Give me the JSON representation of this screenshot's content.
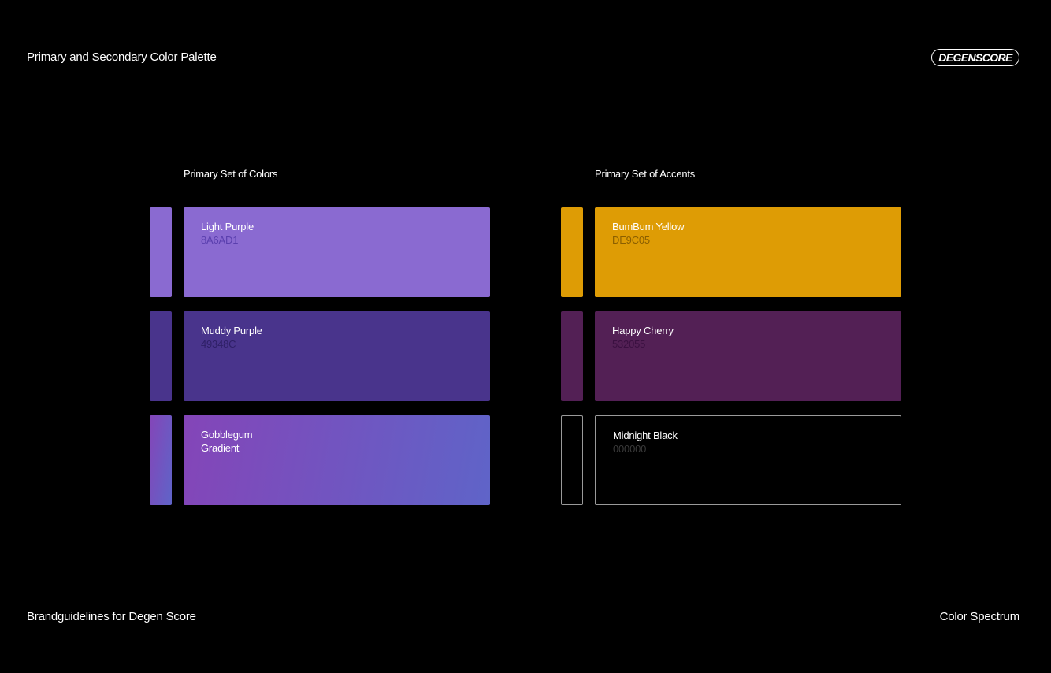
{
  "header": {
    "title": "Primary and Secondary Color Palette",
    "logo_text": "DEGENSCORE"
  },
  "footer": {
    "left": "Brandguidelines for Degen Score",
    "right": "Color Spectrum"
  },
  "primary": {
    "heading": "Primary Set of Colors",
    "swatches": [
      {
        "name": "Light Purple",
        "hex": "8A6AD1",
        "color": "#8A6AD1",
        "hex_text_color": "#5a3fae"
      },
      {
        "name": "Muddy Purple",
        "hex": "49348C",
        "color": "#49348C",
        "hex_text_color": "#2e1f66"
      },
      {
        "name": "Gobblegum\nGradient",
        "hex": "",
        "gradient_from": "#8445B8",
        "gradient_to": "#5F64C8"
      }
    ]
  },
  "accents": {
    "heading": "Primary Set of Accents",
    "swatches": [
      {
        "name": "BumBum Yellow",
        "hex": "DE9C05",
        "color": "#DE9C05",
        "hex_text_color": "#8a5f00"
      },
      {
        "name": "Happy Cherry",
        "hex": "532055",
        "color": "#532055",
        "hex_text_color": "#3a1040"
      },
      {
        "name": "Midnight Black",
        "hex": "000000",
        "color": "#000000",
        "hex_text_color": "#3a3a3a",
        "border": "#9a9a9a"
      }
    ]
  }
}
